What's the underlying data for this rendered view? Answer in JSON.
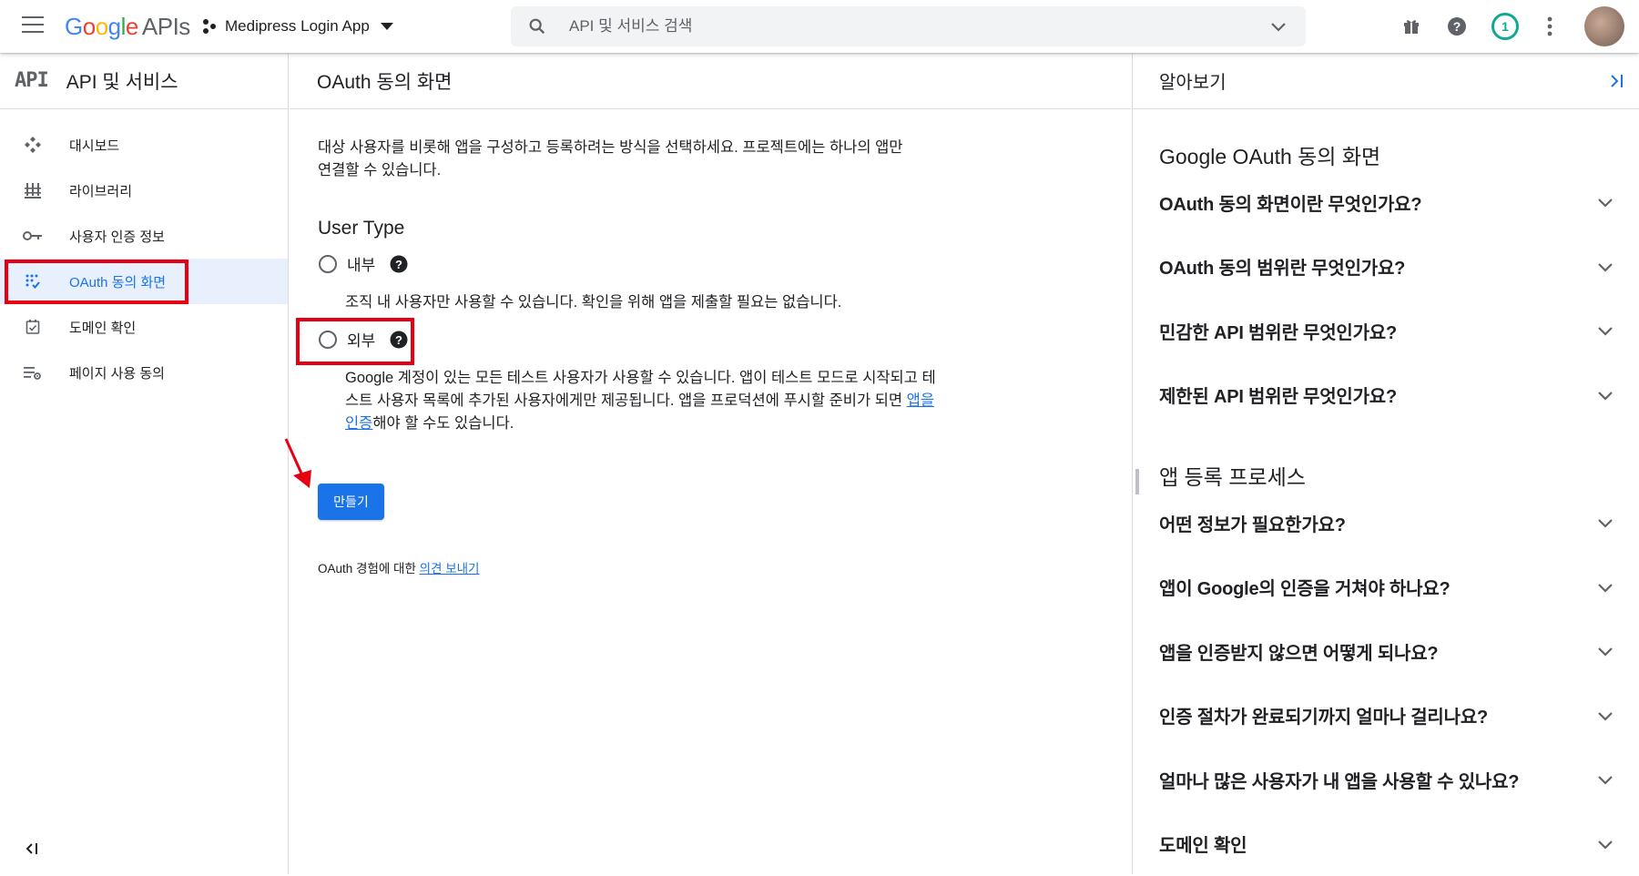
{
  "topbar": {
    "logo_google": "Google",
    "logo_apis": "APIs",
    "project_name": "Medipress Login App",
    "search_placeholder": "API 및 서비스 검색",
    "notification_count": "1"
  },
  "left_nav": {
    "badge": "API",
    "title": "API 및 서비스",
    "items": [
      {
        "label": "대시보드",
        "icon": "dashboard-icon"
      },
      {
        "label": "라이브러리",
        "icon": "library-icon"
      },
      {
        "label": "사용자 인증 정보",
        "icon": "key-icon"
      },
      {
        "label": "OAuth 동의 화면",
        "icon": "oauth-consent-icon",
        "active": true
      },
      {
        "label": "도메인 확인",
        "icon": "domain-check-icon"
      },
      {
        "label": "페이지 사용 동의",
        "icon": "page-usage-icon"
      }
    ]
  },
  "main": {
    "title": "OAuth 동의 화면",
    "description": "대상 사용자를 비롯해 앱을 구성하고 등록하려는 방식을 선택하세요. 프로젝트에는 하나의 앱만 연결할 수 있습니다.",
    "user_type_heading": "User Type",
    "internal": {
      "label": "내부",
      "description": "조직 내 사용자만 사용할 수 있습니다. 확인을 위해 앱을 제출할 필요는 없습니다."
    },
    "external": {
      "label": "외부",
      "description_before": "Google 계정이 있는 모든 테스트 사용자가 사용할 수 있습니다. 앱이 테스트 모드로 시작되고 테스트 사용자 목록에 추가된 사용자에게만 제공됩니다. 앱을 프로덕션에 푸시할 준비가 되면 ",
      "link": "앱을 인증",
      "description_after": "해야 할 수도 있습니다."
    },
    "create_button": "만들기",
    "feedback_prefix": "OAuth 경험에 대한 ",
    "feedback_link": "의견 보내기"
  },
  "right_panel": {
    "title": "알아보기",
    "section1": {
      "heading": "Google OAuth 동의 화면",
      "faqs": [
        "OAuth 동의 화면이란 무엇인가요?",
        "OAuth 동의 범위란 무엇인가요?",
        "민감한 API 범위란 무엇인가요?",
        "제한된 API 범위란 무엇인가요?"
      ]
    },
    "section2": {
      "heading": "앱 등록 프로세스",
      "faqs": [
        "어떤 정보가 필요한가요?",
        "앱이 Google의 인증을 거쳐야 하나요?",
        "앱을 인증받지 않으면 어떻게 되나요?",
        "인증 절차가 완료되기까지 얼마나 걸리나요?",
        "얼마나 많은 사용자가 내 앱을 사용할 수 있나요?",
        "도메인 확인"
      ]
    }
  },
  "colors": {
    "accent": "#1a73e8",
    "annotation_red": "#e60012",
    "notification_teal": "#12a893"
  }
}
